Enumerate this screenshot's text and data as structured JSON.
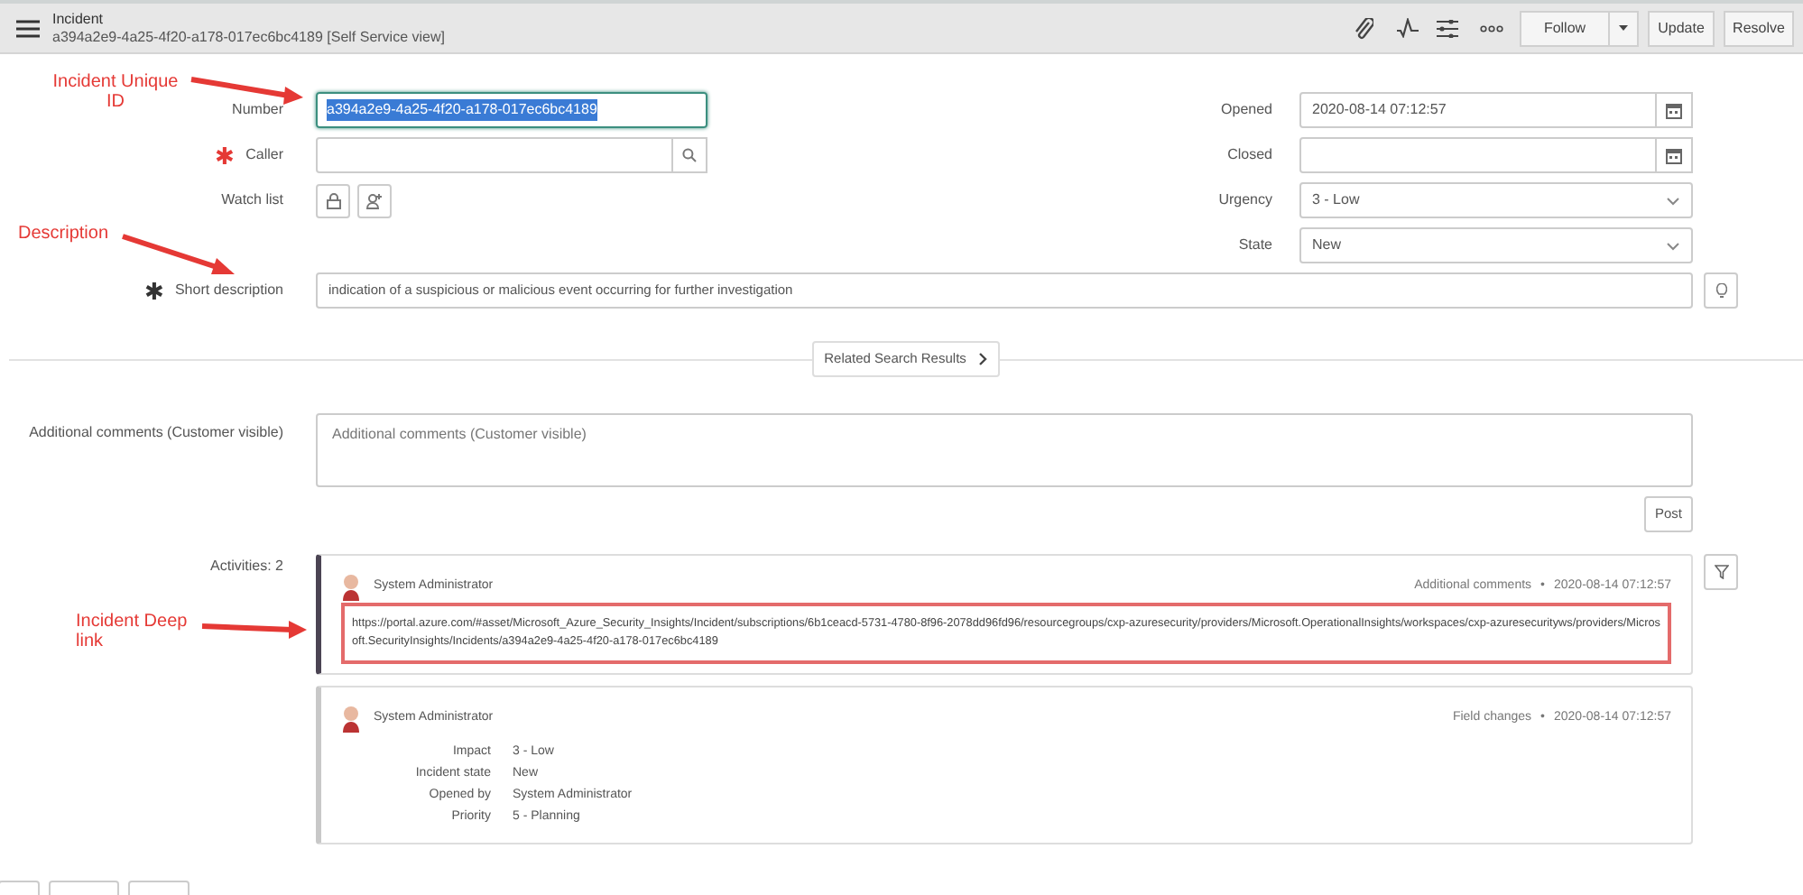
{
  "header": {
    "title": "Incident",
    "subtitle": "a394a2e9-4a25-4f20-a178-017ec6bc4189 [Self Service view]",
    "buttons": [
      "Follow",
      "Update",
      "Resolve"
    ]
  },
  "left_fields": [
    {
      "label": "Number",
      "kind": "text",
      "value": "a394a2e9-4a25-4f20-a178-017ec6bc4189",
      "focused": true
    },
    {
      "label": "Caller",
      "kind": "reference",
      "focused": false,
      "required": {
        "mark": "✱",
        "filled": false
      }
    },
    {
      "label": "Watch list",
      "kind": "watchlist",
      "focused": false
    }
  ],
  "right_fields": [
    {
      "label": "Opened",
      "kind": "date",
      "value": "2020-08-14 07:12:57"
    },
    {
      "label": "Closed",
      "kind": "date"
    },
    {
      "label": "Urgency",
      "kind": "select",
      "value": "3 - Low"
    },
    {
      "label": "State",
      "kind": "select",
      "value": "New"
    }
  ],
  "short_description": {
    "label": "Short description",
    "required": {
      "mark": "✱",
      "filled": true
    },
    "value": "indication of a suspicious or malicious event occurring for further investigation"
  },
  "related_button": "Related Search Results",
  "comments": {
    "label": "Additional comments (Customer visible)",
    "placeholder": "Additional comments (Customer visible)",
    "post_button": "Post"
  },
  "activities": {
    "label": "Activities: 2",
    "entries": [
      {
        "kind": "comment",
        "author": "System Administrator",
        "type_label": "Additional comments",
        "separator": "•",
        "time": "2020-08-14 07:12:57",
        "highlighted": true,
        "text": "https://portal.azure.com/#asset/Microsoft_Azure_Security_Insights/Incident/subscriptions/6b1ceacd-5731-4780-8f96-2078dd96fd96/resourcegroups/cxp-azuresecurity/providers/Microsoft.OperationalInsights/workspaces/cxp-azuresecurityws/providers/Microsoft.SecurityInsights/Incidents/a394a2e9-4a25-4f20-a178-017ec6bc4189"
      },
      {
        "kind": "field_changes",
        "author": "System Administrator",
        "type_label": "Field changes",
        "separator": "•",
        "time": "2020-08-14 07:12:57",
        "highlighted": false,
        "changes": [
          {
            "field": "Impact",
            "value": "3 - Low"
          },
          {
            "field": "Incident state",
            "value": "New"
          },
          {
            "field": "Opened by",
            "value": "System Administrator"
          },
          {
            "field": "Priority",
            "value": "5 - Planning"
          }
        ]
      }
    ]
  },
  "annotations": [
    {
      "text": "Incident Unique ID"
    },
    {
      "text": "Description"
    },
    {
      "text": "Incident Deep link"
    }
  ]
}
